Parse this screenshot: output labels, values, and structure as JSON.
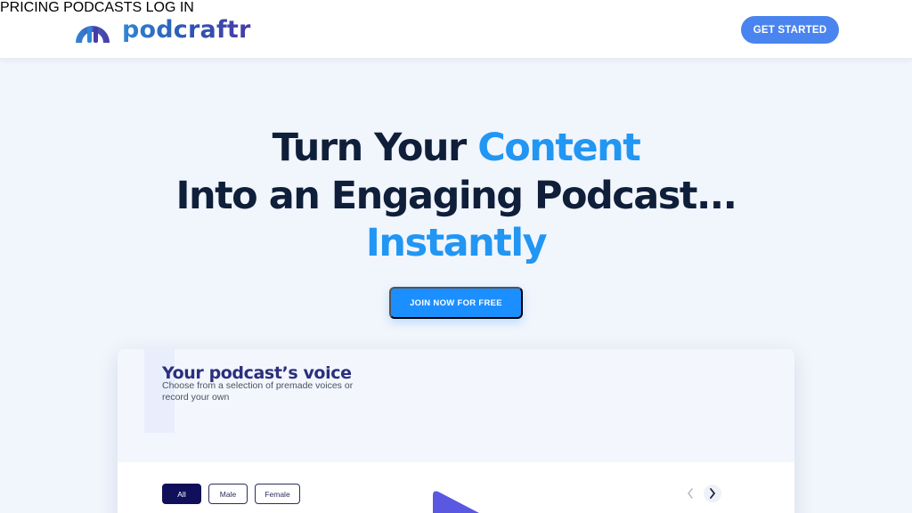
{
  "header": {
    "brand": "podcraftr",
    "nav": [
      "PRICING",
      "PODCASTS",
      "LOG IN"
    ],
    "cta_label": "GET STARTED"
  },
  "hero": {
    "line1_plain": "Turn Your ",
    "line1_accent": "Content",
    "line2": "Into an Engaging Podcast...",
    "line3_accent": "Instantly",
    "join_label": "JOIN NOW FOR FREE"
  },
  "voice_card": {
    "title": "Your podcast’s voice",
    "subtitle": "Choose from a selection of premade voices or record your own",
    "filters": [
      "All",
      "Male",
      "Female"
    ],
    "selected_filter": "All"
  },
  "icons": {
    "logo": "podcraftr-logo-icon",
    "prev": "chevron-left-icon",
    "next": "chevron-right-icon",
    "play": "play-icon"
  },
  "colors": {
    "brand_navy": "#2e3d8a",
    "cta_blue": "#4a84ef",
    "accent_blue": "#2196f3",
    "join_blue": "#1b8fff",
    "heading_dark": "#0f1f3a",
    "chip_active": "#10105a",
    "play_purple": "#5a57e0"
  }
}
